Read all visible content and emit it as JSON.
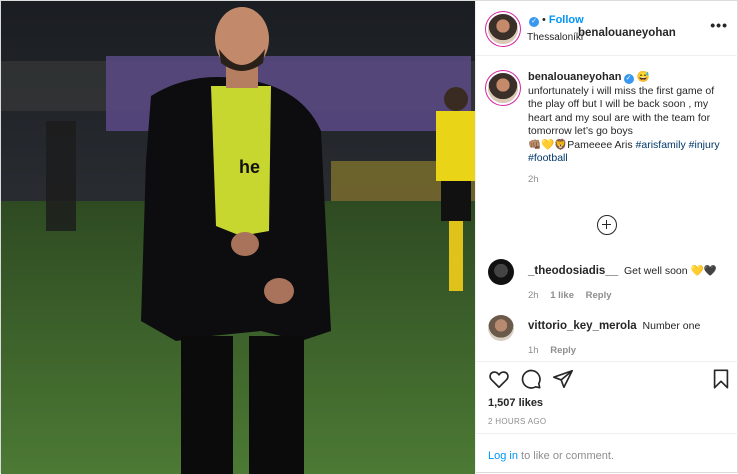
{
  "header": {
    "username": "benalouaneyohan",
    "separator": "•",
    "follow_label": "Follow",
    "location": "Thessaloníki",
    "more_label": "•••"
  },
  "caption": {
    "username": "benalouaneyohan",
    "emoji_after_name": "😅",
    "text": "unfortunately i will miss the first game of the play off but I will be back soon , my heart and my soul are with the team for tomorrow let’s go boys",
    "emojis": "👊🏽💛🦁",
    "tail": "Pameeee Aris",
    "hashtags": [
      "#arisfamily",
      "#injury",
      "#football"
    ],
    "time": "2h"
  },
  "comments": [
    {
      "username": "_theodosiadis__",
      "text": "Get well soon",
      "hearts": [
        "💛",
        "🖤"
      ],
      "time": "2h",
      "likes": "1 like",
      "reply": "Reply"
    },
    {
      "username": "vittorio_key_merola",
      "text": "Number one",
      "time": "1h",
      "reply": "Reply"
    }
  ],
  "actions": {
    "icons": [
      "heart-icon",
      "comment-icon",
      "share-icon",
      "bookmark-icon"
    ],
    "likes": "1,507 likes",
    "posted": "2 HOURS AGO"
  },
  "login": {
    "link": "Log in",
    "rest": "to like or comment."
  },
  "colors": {
    "accent": "#0095f6",
    "verified": "#3897f0",
    "hashtag": "#00376b",
    "muted": "#8e8e8e",
    "pitch": "#3f6a2a"
  }
}
